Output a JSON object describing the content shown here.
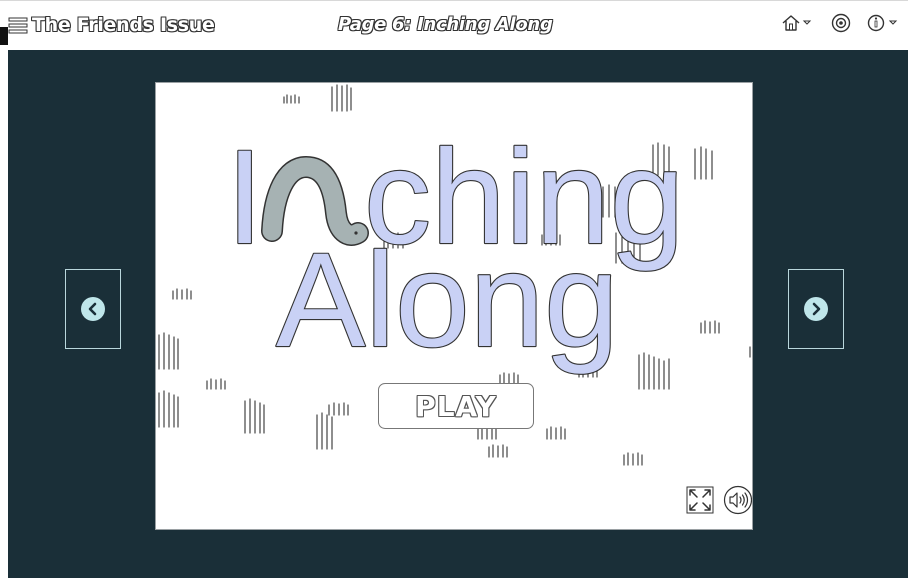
{
  "header": {
    "issue_title": "The Friends Issue",
    "page_title": "Page 6: Inching Along",
    "menu_icon": "hamburger-icon",
    "home_icon": "home-icon",
    "settings_icon": "gear-icon",
    "info_icon": "info-icon"
  },
  "game": {
    "title_line1_a": "I",
    "title_line1_b": "ching",
    "title_line2": "Along",
    "play_label": "PLAY",
    "fullscreen_icon": "fullscreen-icon",
    "sound_icon": "speaker-icon"
  },
  "nav": {
    "prev_icon": "chevron-left-icon",
    "next_icon": "chevron-right-icon"
  },
  "colors": {
    "stage_bg": "#1a2f38",
    "title_fill": "#c9d1f5",
    "worm_fill": "#a6b2b3",
    "nav_circle": "#bfe6ea"
  }
}
